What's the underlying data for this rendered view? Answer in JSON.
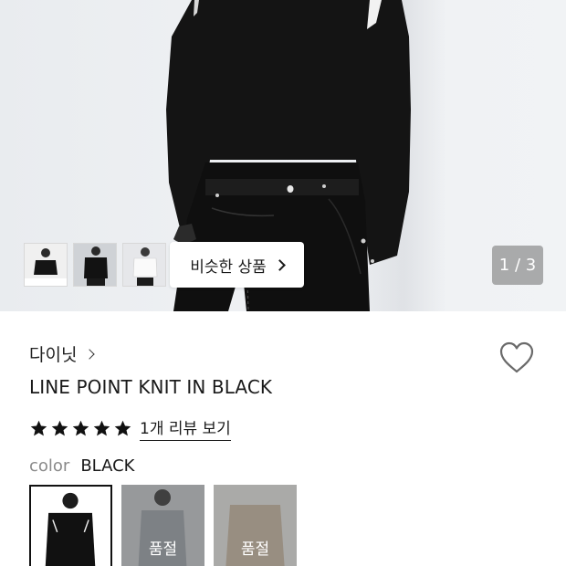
{
  "hero": {
    "similar_label": "비슷한 상품",
    "counter": "1 / 3",
    "thumbnails": [
      {
        "name": "thumbnail-1",
        "palette": "black-on-white"
      },
      {
        "name": "thumbnail-2",
        "palette": "black"
      },
      {
        "name": "thumbnail-3",
        "palette": "white"
      }
    ]
  },
  "product": {
    "brand": "다이닛",
    "title": "LINE POINT KNIT IN BLACK",
    "rating_stars": 5,
    "review_link": "1개 리뷰 보기"
  },
  "color": {
    "label": "color",
    "selected_value": "BLACK",
    "options": [
      {
        "name": "black",
        "selected": true,
        "soldout": false
      },
      {
        "name": "grey",
        "selected": false,
        "soldout": true,
        "soldout_label": "품절"
      },
      {
        "name": "beige",
        "selected": false,
        "soldout": true,
        "soldout_label": "품절"
      }
    ]
  },
  "colors": {
    "text_primary": "#1a1a1a",
    "text_muted": "#8a8a8a",
    "counter_bg": "#828282",
    "knit_black": "#141414"
  }
}
